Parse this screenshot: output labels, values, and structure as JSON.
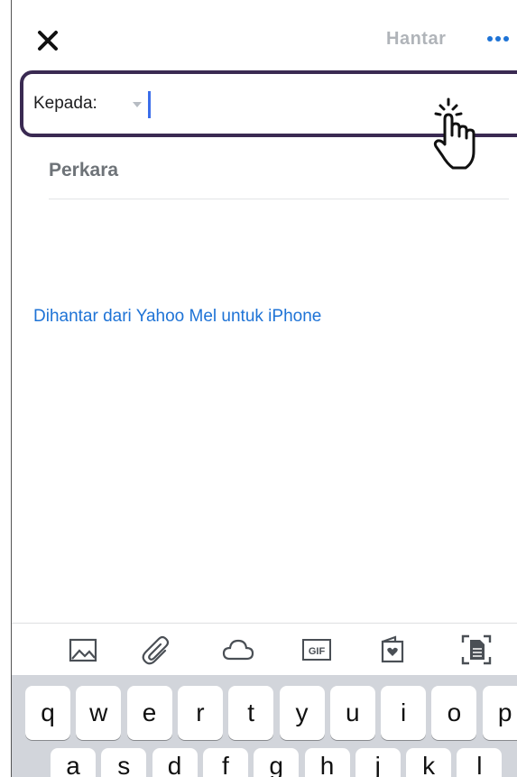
{
  "header": {
    "close_icon": "close-icon",
    "send_label": "Hantar",
    "more_icon": "more-options-icon"
  },
  "compose": {
    "to_label": "Kepada:",
    "to_value": "",
    "subject_placeholder": "Perkara",
    "signature": "Dihantar dari Yahoo Mel untuk iPhone"
  },
  "toolbar": {
    "items": [
      "photo-icon",
      "attachment-icon",
      "cloud-icon",
      "gif-icon",
      "stationery-icon",
      "document-scan-icon"
    ],
    "gif_label": "GIF"
  },
  "keyboard": {
    "row1": [
      "q",
      "w",
      "e",
      "r",
      "t",
      "y",
      "u",
      "i",
      "o",
      "p"
    ],
    "row2": [
      "a",
      "s",
      "d",
      "f",
      "g",
      "h",
      "j",
      "k",
      "l"
    ]
  },
  "colors": {
    "accent": "#1e73d6",
    "highlight_border": "#3a2a52",
    "send_disabled": "#b0b4b9",
    "keyboard_bg": "#d2d5db"
  }
}
